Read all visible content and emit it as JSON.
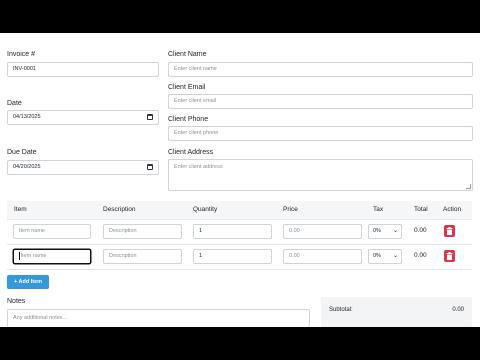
{
  "invoice": {
    "number_label": "Invoice #",
    "number_value": "INV-0001",
    "date_label": "Date",
    "date_value": "04/13/2025",
    "due_label": "Due Date",
    "due_value": "04/20/2025"
  },
  "client": {
    "name_label": "Client Name",
    "name_placeholder": "Enter client name",
    "email_label": "Client Email",
    "email_placeholder": "Enter client email",
    "phone_label": "Client Phone",
    "phone_placeholder": "Enter client phone",
    "address_label": "Client Address",
    "address_placeholder": "Enter client address"
  },
  "table": {
    "headers": {
      "item": "Item",
      "description": "Description",
      "quantity": "Quantity",
      "price": "Price",
      "tax": "Tax",
      "total": "Total",
      "action": "Action"
    },
    "rows": [
      {
        "item_placeholder": "Item name",
        "description_placeholder": "Description",
        "quantity": "1",
        "price_placeholder": "0.00",
        "tax": "0%",
        "total": "0.00"
      },
      {
        "item_placeholder": "Item name",
        "description_placeholder": "Description",
        "quantity": "1",
        "price_placeholder": "0.00",
        "tax": "0%",
        "total": "0.00"
      }
    ]
  },
  "add_item_label": "+ Add Item",
  "notes": {
    "label": "Notes",
    "placeholder": "Any additional notes..."
  },
  "summary": {
    "subtotal_label": "Subtotal:",
    "subtotal_value": "0.00"
  },
  "colors": {
    "primary": "#3498db",
    "danger": "#dc3545"
  }
}
